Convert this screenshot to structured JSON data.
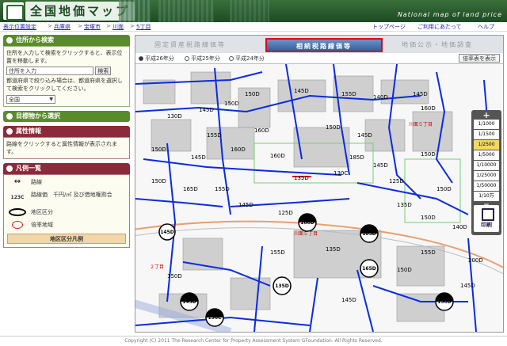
{
  "header": {
    "title": "全国地価マップ",
    "english_title": "National map of land price"
  },
  "breadcrumb": {
    "items": [
      "表示位置設定",
      "兵庫県",
      "宝塚市",
      "川面",
      "5丁目"
    ],
    "separator": ">"
  },
  "toplinks": {
    "top": "トップページ",
    "usage": "ご利用にあたって",
    "help": "ヘルプ"
  },
  "sidebar": {
    "address_search": {
      "heading": "住所から検索",
      "description": "住所を入力して検索をクリックすると、表示位置を移動します。",
      "input_value": "住所を入力",
      "button": "検索",
      "description2": "都道府県で絞り込み場合は、都道府県を選択して検索をクリックしてください。",
      "select_value": "全国"
    },
    "landmark": {
      "heading": "目標物から選択"
    },
    "attribute": {
      "heading": "属性情報",
      "text": "路線をクリックすると属性情報が表示されます。"
    },
    "legend": {
      "heading": "凡例一覧",
      "items": [
        {
          "icon": "↔",
          "label": "路線"
        },
        {
          "icon": "123C",
          "label": "路線価　千円/㎡ 及び借地権割合"
        },
        {
          "icon": "◯",
          "label": "地区区分"
        },
        {
          "icon": "●",
          "label": "倍率地域"
        }
      ],
      "button": "地区区分凡例"
    }
  },
  "map": {
    "tabs": [
      "固定資産税路線価等",
      "相続税路線価等",
      "地価公示・地価調査"
    ],
    "active_tab": "相続税路線価等",
    "years": [
      "平成26年分",
      "平成25年分",
      "平成24年分"
    ],
    "selected_year": "平成26年分",
    "ratio_button": "倍率表を表示",
    "zoom_levels": [
      "1/1000",
      "1/1500",
      "1/2500",
      "1/5000",
      "1/10000",
      "1/25000",
      "1/50000",
      "1/10万"
    ],
    "active_zoom": "1/2500",
    "print_label": "印刷",
    "district_labels": [
      "川面５丁目",
      "川面５丁目",
      "２丁目"
    ],
    "price_labels": [
      "130D",
      "145D",
      "150D",
      "150D",
      "145D",
      "155D",
      "140D",
      "145D",
      "160D",
      "155D",
      "160D",
      "150D",
      "145D",
      "150D",
      "145D",
      "160D",
      "160D",
      "185D",
      "145D",
      "150D",
      "150D",
      "165D",
      "155D",
      "135D",
      "130C",
      "125D",
      "150D",
      "145D",
      "125D",
      "135D",
      "150D",
      "140D",
      "135D",
      "145D",
      "200D",
      "145D",
      "155D",
      "150D",
      "155D",
      "150D"
    ],
    "circle_labels": [
      "160D",
      "185D",
      "165D",
      "150D",
      "135D",
      "145D",
      "145D",
      "190C"
    ],
    "colors": {
      "road": "#0a2be0",
      "highlight": "#e00000",
      "tab_active": "#33609d"
    }
  },
  "footer": "Copyright (C) 2011 The Research Center for Property Assessment System GFoundation. All Rights Reserved."
}
